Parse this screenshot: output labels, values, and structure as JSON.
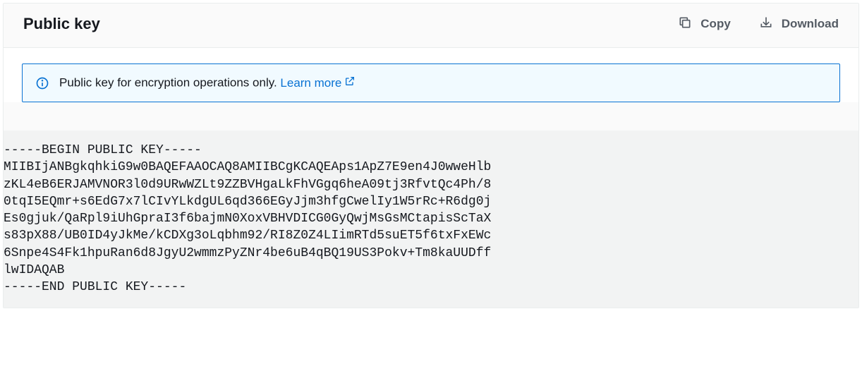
{
  "header": {
    "title": "Public key",
    "actions": {
      "copy_label": "Copy",
      "download_label": "Download"
    }
  },
  "alert": {
    "message": "Public key for encryption operations only. ",
    "link_label": "Learn more"
  },
  "public_key_pem": "-----BEGIN PUBLIC KEY-----\nMIIBIjANBgkqhkiG9w0BAQEFAAOCAQ8AMIIBCgKCAQEAps1ApZ7E9en4J0wweHlb\nzKL4eB6ERJAMVNOR3l0d9URwWZLt9ZZBVHgaLkFhVGgq6heA09tj3RfvtQc4Ph/8\n0tqI5EQmr+s6EdG7x7lCIvYLkdgUL6qd366EGyJjm3hfgCwelIy1W5rRc+R6dg0j\nEs0gjuk/QaRpl9iUhGpraI3f6bajmN0XoxVBHVDICG0GyQwjMsGsMCtapisScTaX\ns83pX88/UB0ID4yJkMe/kCDXg3oLqbhm92/RI8Z0Z4LIimRTd5suET5f6txFxEWc\n6Snpe4S4Fk1hpuRan6d8JgyU2wmmzPyZNr4be6uB4qBQ19US3Pokv+Tm8kaUUDff\nlwIDAQAB\n-----END PUBLIC KEY-----"
}
